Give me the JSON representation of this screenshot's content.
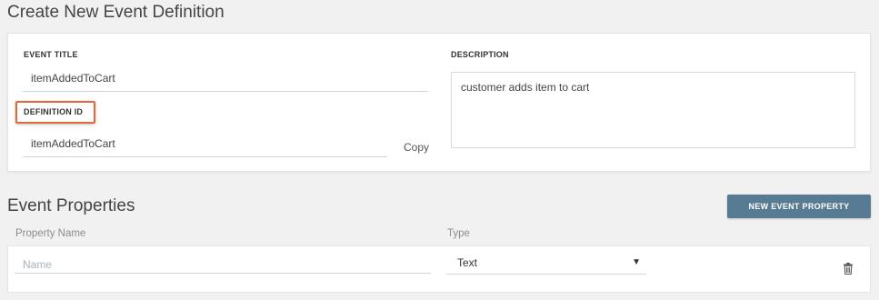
{
  "page": {
    "title": "Create New Event Definition"
  },
  "definition": {
    "event_title_label": "EVENT TITLE",
    "event_title_value": "itemAddedToCart",
    "definition_id_label": "DEFINITION ID",
    "definition_id_value": "itemAddedToCart",
    "copy_label": "Copy",
    "description_label": "DESCRIPTION",
    "description_value": "customer adds item to cart"
  },
  "properties": {
    "title": "Event Properties",
    "new_button": "NEW EVENT PROPERTY",
    "columns": {
      "name": "Property Name",
      "type": "Type"
    },
    "rows": [
      {
        "name_placeholder": "Name",
        "name_value": "",
        "type_value": "Text"
      }
    ]
  },
  "icons": {
    "caret": "caret-down-icon",
    "delete": "trash-icon"
  },
  "colors": {
    "highlight": "#e06a3a",
    "button": "#567b93"
  }
}
